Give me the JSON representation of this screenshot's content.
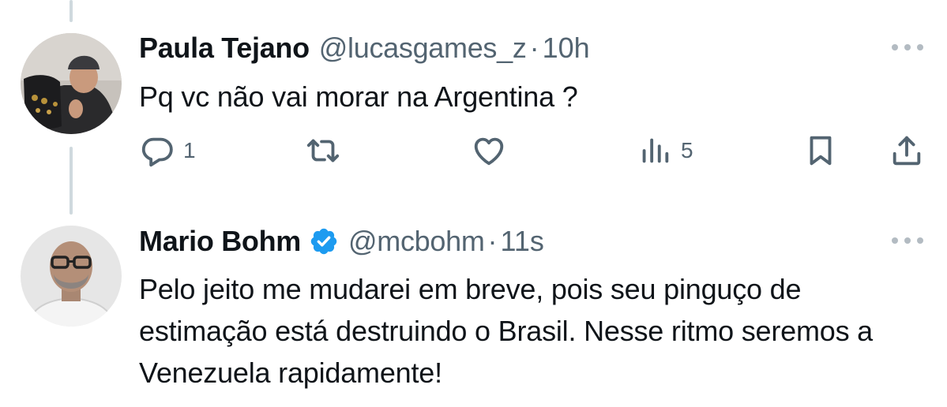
{
  "tweets": [
    {
      "name": "Paula Tejano",
      "handle": "@lucasgames_z",
      "separator": "·",
      "time": "10h",
      "text": "Pq vc não vai morar na Argentina  ?",
      "verified": false,
      "actions": {
        "reply_count": "1",
        "retweet_count": "",
        "like_count": "",
        "views_count": "5"
      }
    },
    {
      "name": "Mario Bohm",
      "handle": "@mcbohm",
      "separator": "·",
      "time": "11s",
      "text": "Pelo jeito me mudarei em breve, pois seu pinguço de estimação está destruindo o Brasil. Nesse ritmo seremos a Venezuela rapidamente!",
      "verified": true
    }
  ],
  "icons": {
    "reply": "reply-icon",
    "retweet": "retweet-icon",
    "like": "heart-icon",
    "views": "views-icon",
    "bookmark": "bookmark-icon",
    "share": "share-icon",
    "more": "more-icon",
    "verified": "verified-badge-icon"
  },
  "colors": {
    "text": "#0f1419",
    "secondary": "#536471",
    "verified": "#1d9bf0",
    "thread_line": "#cfd9de"
  }
}
